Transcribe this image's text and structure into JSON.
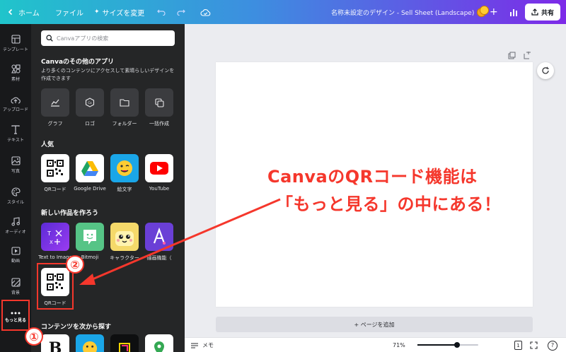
{
  "topbar": {
    "home": "ホーム",
    "file": "ファイル",
    "resize": "サイズを変更",
    "title": "名称未設定のデザイン - Sell Sheet (Landscape)",
    "share": "共有"
  },
  "rail": [
    {
      "label": "テンプレート",
      "icon": "template-icon"
    },
    {
      "label": "素材",
      "icon": "elements-icon"
    },
    {
      "label": "アップロード",
      "icon": "upload-icon"
    },
    {
      "label": "テキスト",
      "icon": "text-icon"
    },
    {
      "label": "写真",
      "icon": "photo-icon"
    },
    {
      "label": "スタイル",
      "icon": "style-icon"
    },
    {
      "label": "オーディオ",
      "icon": "audio-icon"
    },
    {
      "label": "動画",
      "icon": "video-icon"
    },
    {
      "label": "背景",
      "icon": "background-icon"
    },
    {
      "label": "もっと見る",
      "icon": "more-icon"
    }
  ],
  "panel": {
    "search_placeholder": "Canvaアプリの検索",
    "more_apps_title": "Canvaのその他のアプリ",
    "more_apps_desc": "より多くのコンテンツにアクセスして素晴らしいデザインを作成できます",
    "tools": [
      "グラフ",
      "ロゴ",
      "フォルダー",
      "一括作成"
    ],
    "popular_title": "人気",
    "popular": [
      "QRコード",
      "Google Drive",
      "絵文字",
      "YouTube"
    ],
    "create_title": "新しい作品を作ろう",
    "create": [
      "Text to Image",
      "Bitmoji",
      "キャラクター",
      "描画機能（"
    ],
    "qr_label": "QRコード",
    "explore_title": "コンテンツを次から探す"
  },
  "canvas": {
    "add_page": "+ ページを追加"
  },
  "bottombar": {
    "notes": "メモ",
    "zoom": "71%",
    "zoom_fraction": 0.65,
    "page_count": "1",
    "help": "?"
  },
  "annotation": {
    "line1": "CanvaのQRコード機能は",
    "line2": "「もっと見る」の中にある！",
    "badge1": "①",
    "badge2": "②"
  },
  "colors": {
    "accent_red": "#f5372c",
    "rail_bg": "#18191b",
    "panel_bg": "#252627"
  }
}
